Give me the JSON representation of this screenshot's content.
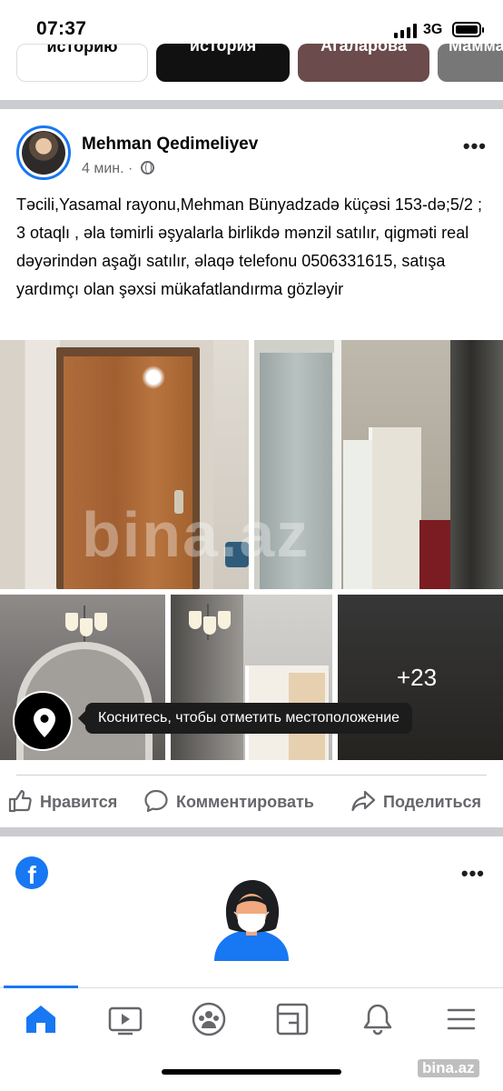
{
  "status_bar": {
    "time": "07:37",
    "network": "3G"
  },
  "stories": [
    {
      "label": "историю"
    },
    {
      "label": "история"
    },
    {
      "label": "Агаларова"
    },
    {
      "label": "Мамма"
    }
  ],
  "post": {
    "author": "Mehman Qedimeliyev",
    "time": "4 мин.",
    "separator": "·",
    "text": "Təcili,Yasamal rayonu,Mehman Bünyadzadə küçəsi 153-də;5/2 ; 3 otaqlı , əla təmirli əşyalarla birlikdə mənzil satılır, qigməti real dəyərindən aşağı satılır, əlaqə telefonu 0506331615, satışa yardımçı olan şəxsi mükafatlandırma gözləyir",
    "photo_watermark": "bina.az",
    "more_photos": "+23",
    "location_tip": "Коснитесь, чтобы отметить местоположение",
    "more": "•••"
  },
  "actions": {
    "like": "Нравится",
    "comment": "Комментировать",
    "share": "Поделиться"
  },
  "next_card": {
    "logo": "f",
    "more": "•••"
  },
  "bottom_nav": [
    "home-icon",
    "video-icon",
    "groups-icon",
    "marketplace-icon",
    "bell-icon",
    "menu-icon"
  ],
  "watermark": "bina.az",
  "colors": {
    "accent": "#1877f2",
    "muted": "#65676b",
    "separator": "#cacccf"
  }
}
